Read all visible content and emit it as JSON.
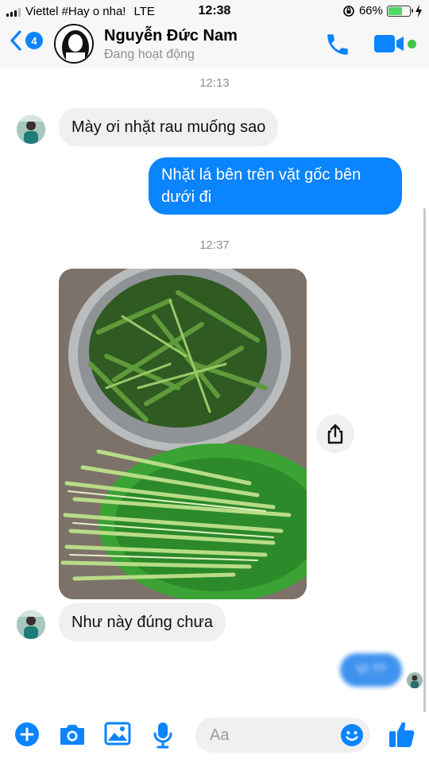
{
  "status_bar": {
    "carrier": "Viettel #Hay o nha!",
    "network": "LTE",
    "time": "12:38",
    "battery": "66%",
    "battery_level": 0.66
  },
  "header": {
    "unread_count": "4",
    "contact_name": "Nguyễn Đức Nam",
    "contact_status": "Đang hoạt động",
    "icons": {
      "back": "chevron-left-icon",
      "call": "phone-icon",
      "video": "video-camera-icon"
    },
    "accent_color": "#0a84ff"
  },
  "chat": {
    "timestamp_1": "12:13",
    "message_1": "Mày ơi nhặt rau muống sao",
    "message_2_line1": "Nhặt lá bên trên vặt gốc bên",
    "message_2_line2": "dưới đi",
    "timestamp_2": "12:37",
    "message_4": "Như này đúng chưa",
    "message_5_blurred": "Vl ??"
  },
  "composer": {
    "placeholder": "Aa",
    "icons": [
      "plus-icon",
      "camera-icon",
      "image-icon",
      "microphone-icon",
      "emoji-icon",
      "thumbs-up-icon"
    ]
  }
}
